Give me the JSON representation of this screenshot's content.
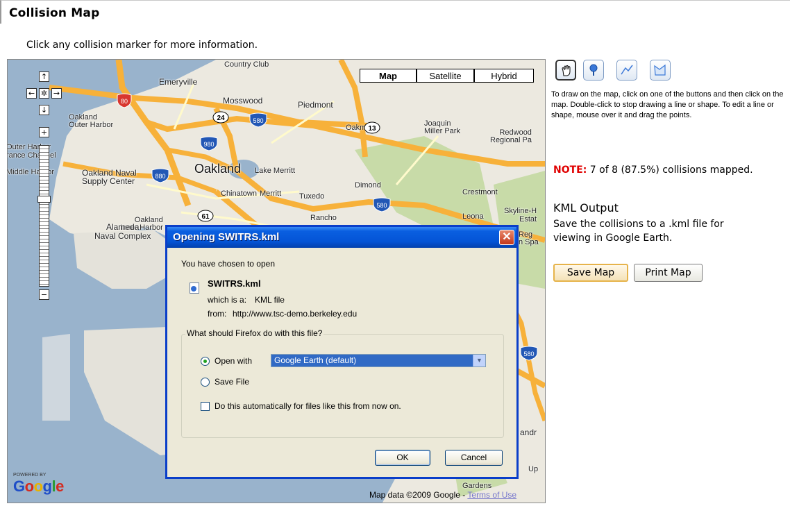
{
  "page": {
    "title": "Collision Map",
    "instructions": "Click any collision marker for more information."
  },
  "map": {
    "type_buttons": [
      {
        "label": "Map",
        "active": true
      },
      {
        "label": "Satellite",
        "active": false
      },
      {
        "label": "Hybrid",
        "active": false
      }
    ],
    "labels": {
      "emeryville": "Emeryville",
      "mosswood": "Mosswood",
      "piedmont": "Piedmont",
      "oakland_outer_harbor": "Oakland\nOuter Harbor",
      "joaquin_miller": "Joaquin\nMiller Park",
      "redwood": "Redwood\nRegional Pa",
      "oakmore": "Oakmore",
      "outer_harbor": "Outer Harbor",
      "entrance_channel": "rance Channel",
      "oakland_naval": "Oakland Naval\nSupply Center",
      "oakland": "Oakland",
      "lake_merritt": "Lake Merritt",
      "middle_harbor": "Middle Harbor",
      "chinatown": "Chinatown",
      "merritt": "Merritt",
      "tuxedo": "Tuxedo",
      "dimond": "Dimond",
      "crestmont": "Crestmont",
      "inner_harbor": "Oakland\nInner Harbor",
      "rancho": "Rancho",
      "leona": "Leona",
      "skyline": "Skyline-H\nEstat",
      "alameda_naval": "Alameda\nNaval Complex",
      "country_club": "Country Club",
      "gardens": "Gardens",
      "reg": "Reg\nn Spa",
      "andr": "andr",
      "up": "Up"
    },
    "shields": {
      "i80": "80",
      "i580a": "580",
      "r24": "24",
      "r13": "13",
      "i980": "980",
      "i880": "880",
      "i580b": "580",
      "r61": "61",
      "i580c": "580"
    },
    "powered_by": "POWERED BY",
    "logo": "Google",
    "copyright": "Map data ©2009 Google - ",
    "terms": "Terms of Use"
  },
  "dialog": {
    "title": "Opening SWITRS.kml",
    "chosen_text": "You have chosen to open",
    "filename": "SWITRS.kml",
    "which_is_label": "which is a:",
    "which_is_value": "KML file",
    "from_label": "from:",
    "from_value": "http://www.tsc-demo.berkeley.edu",
    "question": "What should Firefox do with this file?",
    "open_with_label": "Open with",
    "open_with_value": "Google Earth (default)",
    "save_file_label": "Save File",
    "auto_label": "Do this automatically for files like this from now on.",
    "ok_label": "OK",
    "cancel_label": "Cancel"
  },
  "tools": [
    {
      "name": "hand-tool",
      "icon": "hand-icon",
      "active": true
    },
    {
      "name": "marker-tool",
      "icon": "placemark-icon",
      "active": false
    },
    {
      "name": "line-tool",
      "icon": "polyline-icon",
      "active": false
    },
    {
      "name": "shape-tool",
      "icon": "polygon-icon",
      "active": false
    }
  ],
  "panel": {
    "help": "To draw on the map, click on one of the buttons and then click on the map. Double-click to stop drawing a line or shape. To edit a line or shape, mouse over it and drag the points.",
    "note_label": "NOTE:",
    "note_text": " 7 of 8 (87.5%) collisions mapped.",
    "kml_title": "KML Output",
    "kml_desc": "Save the collisions to a .kml file for viewing in Google Earth.",
    "save_map": "Save Map",
    "print_map": "Print Map"
  },
  "colors": {
    "accent_blue": "#0a3ec9",
    "note_red": "#e00000",
    "freeway": "#f7b13a",
    "water": "#99b3cc",
    "park": "#c8dba8"
  }
}
